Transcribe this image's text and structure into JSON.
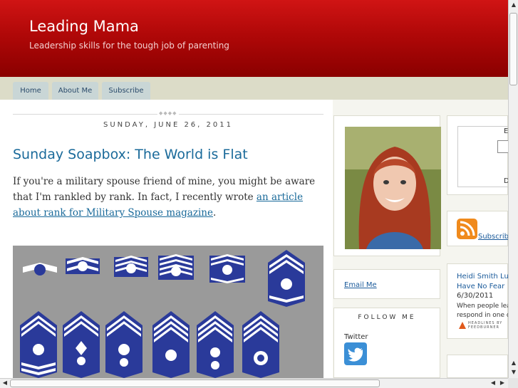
{
  "blog": {
    "title": "Leading Mama",
    "description": "Leadership skills for the tough job of parenting"
  },
  "nav": {
    "tabs": [
      {
        "label": "Home"
      },
      {
        "label": "About Me"
      },
      {
        "label": "Subscribe"
      }
    ]
  },
  "post": {
    "date": "Sunday, June 26, 2011",
    "title": "Sunday Soapbox: The World is Flat",
    "body_prefix": "If you're a military spouse friend of mine, you might be aware that I'm rankled by rank. In fact, I recently wrote ",
    "link_text": "an article about rank for Military Spouse magazine",
    "body_suffix": ".",
    "image_alt": "Air Force enlisted rank insignia chevrons"
  },
  "sidebar": {
    "email_link": "Email Me",
    "follow_title": "FOLLOW ME",
    "twitter_label": "Twitter",
    "partial_top_letter_1": "E",
    "partial_top_letter_2": "D",
    "subscribe_link": "Subscribe",
    "feed": {
      "title_line1": "Heidi Smith Luedt",
      "title_line2": "Have No Fear",
      "date": "6/30/2011",
      "snippet_line1": "When people lea",
      "snippet_line2": "respond in one o",
      "badge_line1": "HEADLINES BY",
      "badge_line2": "FEEDBURNER"
    }
  },
  "colors": {
    "header_red": "#b00808",
    "link_blue": "#1a6a9a",
    "nav_tab": "#c9d6d6",
    "insignia_blue": "#2a3a9a",
    "insignia_bg": "#9a9a9a"
  }
}
